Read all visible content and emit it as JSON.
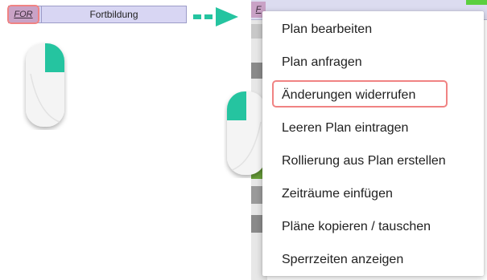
{
  "left_row": {
    "code": "FOR",
    "label": "Fortbildung"
  },
  "right_row": {
    "code": "F"
  },
  "context_menu": {
    "items": [
      {
        "label": "Plan bearbeiten"
      },
      {
        "label": "Plan anfragen"
      },
      {
        "label": "Änderungen widerrufen",
        "highlighted": true
      },
      {
        "label": "Leeren Plan eintragen"
      },
      {
        "label": "Rollierung aus Plan erstellen"
      },
      {
        "label": "Zeiträume einfügen"
      },
      {
        "label": "Pläne kopieren / tauschen"
      },
      {
        "label": "Sperrzeiten anzeigen"
      }
    ]
  },
  "colors": {
    "accent_teal": "#25c4a0",
    "highlight_red": "#f08383",
    "row_lavender": "#d8d6f3",
    "code_mauve": "#c9a2c6"
  },
  "icons": [
    "mouse-left-click-icon",
    "arrow-right-icon",
    "mouse-right-click-icon"
  ]
}
